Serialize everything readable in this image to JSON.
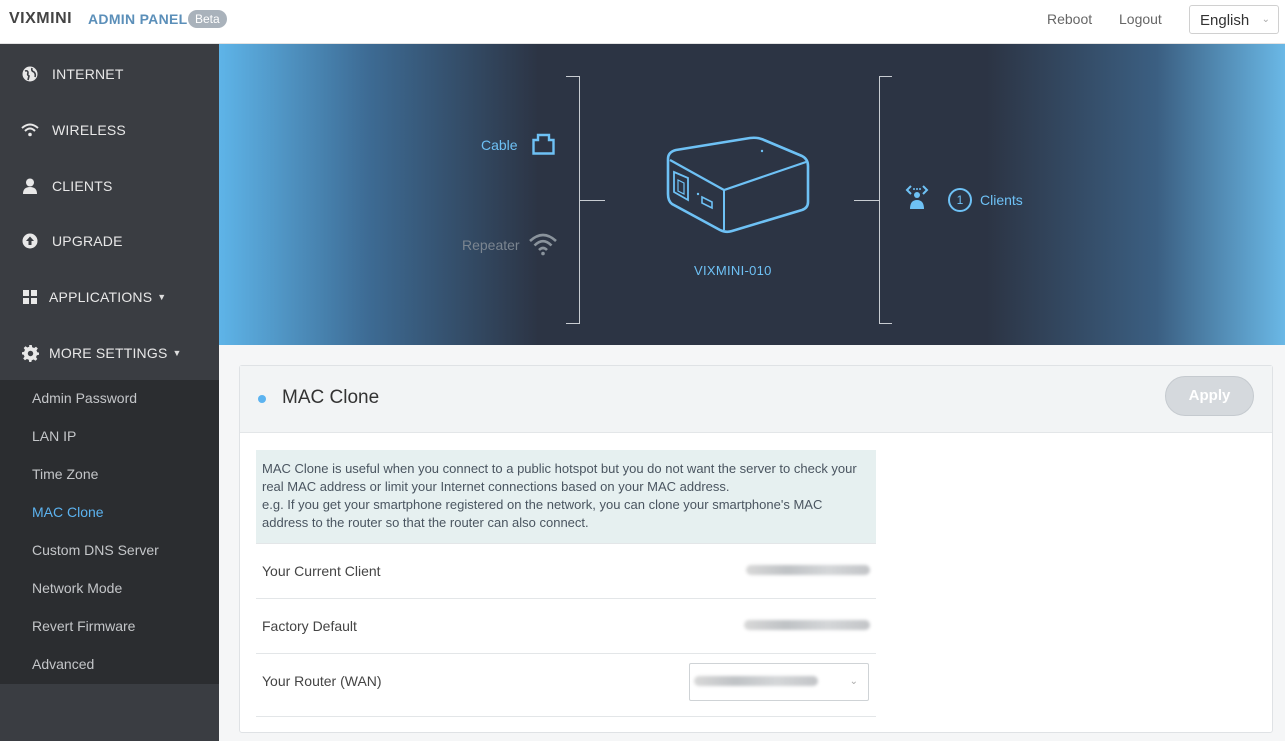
{
  "header": {
    "brand": "VIXMINI",
    "panel_label": "ADMIN PANEL",
    "badge": "Beta",
    "reboot": "Reboot",
    "logout": "Logout",
    "language": "English"
  },
  "sidebar": {
    "items": [
      {
        "label": "INTERNET",
        "icon": "globe-icon"
      },
      {
        "label": "WIRELESS",
        "icon": "wifi-icon"
      },
      {
        "label": "CLIENTS",
        "icon": "user-icon"
      },
      {
        "label": "UPGRADE",
        "icon": "upload-icon"
      },
      {
        "label": "APPLICATIONS",
        "icon": "grid-icon",
        "has_caret": true
      },
      {
        "label": "MORE SETTINGS",
        "icon": "gear-icon",
        "has_caret": true
      }
    ],
    "submenu": [
      {
        "label": "Admin Password"
      },
      {
        "label": "LAN IP"
      },
      {
        "label": "Time Zone"
      },
      {
        "label": "MAC Clone",
        "active": true
      },
      {
        "label": "Custom DNS Server"
      },
      {
        "label": "Network Mode"
      },
      {
        "label": "Revert Firmware"
      },
      {
        "label": "Advanced"
      }
    ]
  },
  "banner": {
    "cable": "Cable",
    "repeater": "Repeater",
    "device": "VIXMINI-010",
    "clients_count": "1",
    "clients": "Clients"
  },
  "panel": {
    "title": "MAC Clone",
    "apply": "Apply",
    "info_lines": [
      "MAC Clone is useful when you connect to a public hotspot but you do not want the server to check your",
      "real MAC address or limit your Internet connections based on your MAC address.",
      "e.g. If you get your smartphone registered on the network, you can clone your smartphone's MAC",
      "address to the router so that the router can also connect."
    ],
    "rows": [
      {
        "label": "Your Current Client"
      },
      {
        "label": "Factory Default"
      },
      {
        "label": "Your Router (WAN)"
      }
    ]
  },
  "colors": {
    "accent": "#5cb3f0",
    "sidebar_bg": "#3a3d42",
    "submenu_bg": "#2b2d30",
    "banner_dark": "#2c3444"
  }
}
